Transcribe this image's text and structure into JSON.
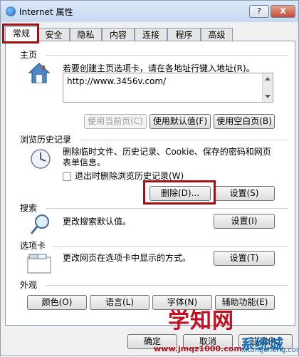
{
  "window": {
    "title": "Internet 属性",
    "help": "?",
    "close": "X"
  },
  "tabs": [
    "常规",
    "安全",
    "隐私",
    "内容",
    "连接",
    "程序",
    "高级"
  ],
  "homepage": {
    "section": "主页",
    "description": "若要创建主页选项卡，请在各地址行键入地址(R)。",
    "url": "http://www.3456v.com/",
    "buttons": [
      "使用当前页(C)",
      "使用默认值(F)",
      "使用空白页(B)"
    ]
  },
  "history": {
    "section": "浏览历史记录",
    "description1": "删除临时文件、历史记录、Cookie、保存的密码和网页",
    "description2": "表单信息。",
    "checkbox": "退出时删除浏览历史记录(W)",
    "delete": "删除(D)...",
    "settings": "设置(S)"
  },
  "search": {
    "section": "搜索",
    "description": "更改搜索默认值。",
    "settings": "设置(I)"
  },
  "tabs_section": {
    "section": "选项卡",
    "description": "更改网页在选项卡中显示的方式。",
    "settings": "设置(T)"
  },
  "appearance": {
    "section": "外观",
    "buttons": [
      "颜色(O)",
      "语言(L)",
      "字体(N)",
      "辅助功能(E)"
    ]
  },
  "footer": {
    "ok": "确定",
    "cancel": "取消",
    "apply": "应用(A)"
  },
  "watermark": {
    "main": "学知网",
    "sub": "www.jmqz1000.com",
    "brand": "系统城",
    "brand_sub": "xitongcheng.com"
  }
}
